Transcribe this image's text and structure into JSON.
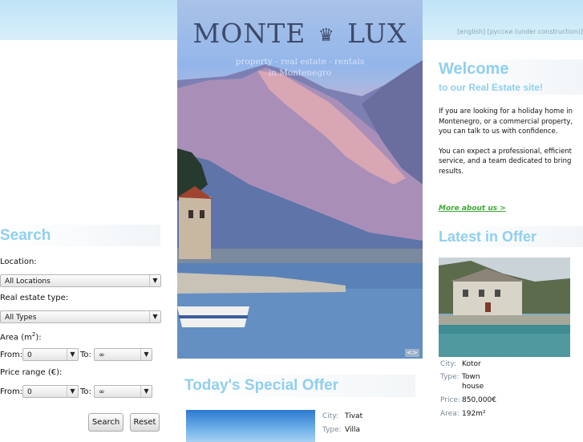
{
  "lang_links": [
    "[english]",
    "[русски (under construction)]"
  ],
  "hero": {
    "brand_left": "MONTE",
    "brand_right": "LUX",
    "crown_icon": "crown-icon",
    "tagline_line1": "property - real estate - rentals",
    "tagline_line2": "in Montenegro",
    "expand_glyph": "<>"
  },
  "search": {
    "title": "Search",
    "location_label": "Location:",
    "location_value": "All Locations",
    "type_label": "Real estate type:",
    "type_value": "All Types",
    "area_label": "Area (m",
    "area_sup": "2",
    "area_label_end": "):",
    "price_label": "Price range (€):",
    "from_label": "From:",
    "to_label": "To:",
    "area_from": "0",
    "area_to": "∞",
    "price_from": "0",
    "price_to": "∞",
    "search_button": "Search",
    "reset_button": "Reset"
  },
  "special": {
    "title": "Today's Special Offer",
    "city_key": "City:",
    "city_val": "Tivat",
    "type_key": "Type:",
    "type_val": "Villa"
  },
  "welcome": {
    "title": "Welcome",
    "subtitle": "to our Real Estate site!",
    "para1": "If you are looking for a holiday home in Montenegro, or a commercial property, you can talk to us with confidence.",
    "para2": "You can expect a professional, efficient service, and a team dedicated to bring results.",
    "more_link": "More about us >"
  },
  "latest": {
    "title": "Latest in Offer",
    "city_key": "City:",
    "city_val": "Kotor",
    "type_key": "Type:",
    "type_val_1": "Town",
    "type_val_2": "house",
    "price_key": "Price:",
    "price_val": "850,000€",
    "area_key": "Area:",
    "area_val": "192m²"
  },
  "colors": {
    "heading_blue": "#8fcfee",
    "link_green": "#3fa835",
    "top_band": "#c9e8f7"
  }
}
